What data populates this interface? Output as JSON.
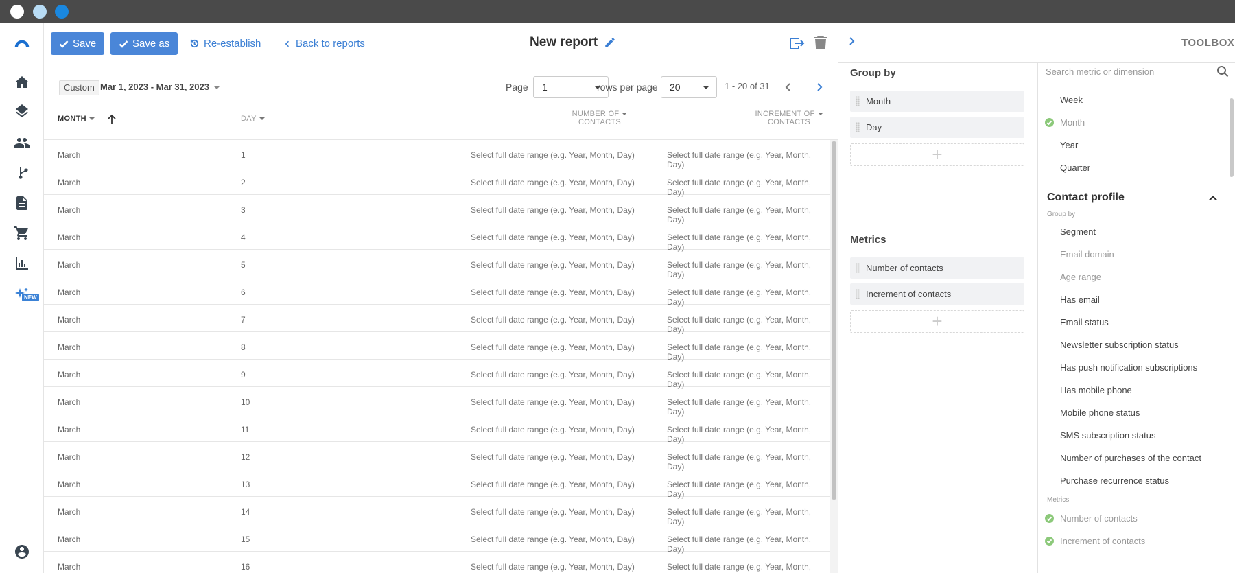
{
  "toolbar": {
    "save_label": "Save",
    "save_as_label": "Save as",
    "reestablish_label": "Re-establish",
    "back_label": "Back to reports",
    "report_title": "New report"
  },
  "filters": {
    "custom_label": "Custom",
    "date_range": "Mar 1, 2023 - Mar 31, 2023",
    "page_label": "Page",
    "page_value": "1",
    "rows_label": "rows per page",
    "rows_value": "20",
    "range_text": "1 - 20 of 31"
  },
  "table": {
    "headers": {
      "month": "MONTH",
      "day": "DAY",
      "noc_line1": "NUMBER OF",
      "noc_line2": "CONTACTS",
      "inc_line1": "INCREMENT OF",
      "inc_line2": "CONTACTS"
    },
    "placeholder": "Select full date range (e.g. Year, Month, Day)",
    "rows": [
      {
        "month": "March",
        "day": "1"
      },
      {
        "month": "March",
        "day": "2"
      },
      {
        "month": "March",
        "day": "3"
      },
      {
        "month": "March",
        "day": "4"
      },
      {
        "month": "March",
        "day": "5"
      },
      {
        "month": "March",
        "day": "6"
      },
      {
        "month": "March",
        "day": "7"
      },
      {
        "month": "March",
        "day": "8"
      },
      {
        "month": "March",
        "day": "9"
      },
      {
        "month": "March",
        "day": "10"
      },
      {
        "month": "March",
        "day": "11"
      },
      {
        "month": "March",
        "day": "12"
      },
      {
        "month": "March",
        "day": "13"
      },
      {
        "month": "March",
        "day": "14"
      },
      {
        "month": "March",
        "day": "15"
      },
      {
        "month": "March",
        "day": "16"
      }
    ]
  },
  "panel": {
    "group_by_title": "Group by",
    "group_by_items": [
      "Month",
      "Day"
    ],
    "metrics_title": "Metrics",
    "metrics_items": [
      "Number of contacts",
      "Increment of contacts"
    ]
  },
  "toolbox": {
    "title": "TOOLBOX",
    "search_placeholder": "Search metric or dimension",
    "date_items": [
      {
        "label": "Week",
        "selected": false
      },
      {
        "label": "Month",
        "selected": true
      },
      {
        "label": "Year",
        "selected": false
      },
      {
        "label": "Quarter",
        "selected": false
      }
    ],
    "contact_profile_title": "Contact profile",
    "group_by_sub": "Group by",
    "group_by_items": [
      {
        "label": "Segment",
        "muted": false
      },
      {
        "label": "Email domain",
        "muted": true
      },
      {
        "label": "Age range",
        "muted": true
      },
      {
        "label": "Has email",
        "muted": false
      },
      {
        "label": "Email status",
        "muted": false
      },
      {
        "label": "Newsletter subscription status",
        "muted": false
      },
      {
        "label": "Has push notification subscriptions",
        "muted": false
      },
      {
        "label": "Has mobile phone",
        "muted": false
      },
      {
        "label": "Mobile phone status",
        "muted": false
      },
      {
        "label": "SMS subscription status",
        "muted": false
      },
      {
        "label": "Number of purchases of the contact",
        "muted": false
      },
      {
        "label": "Purchase recurrence status",
        "muted": false
      }
    ],
    "metrics_sub": "Metrics",
    "metrics_items": [
      {
        "label": "Number of contacts",
        "selected": true
      },
      {
        "label": "Increment of contacts",
        "selected": true
      }
    ]
  },
  "colors": {
    "accent": "#4a86d8",
    "link": "#3b7fd4",
    "check": "#8cc97a"
  }
}
